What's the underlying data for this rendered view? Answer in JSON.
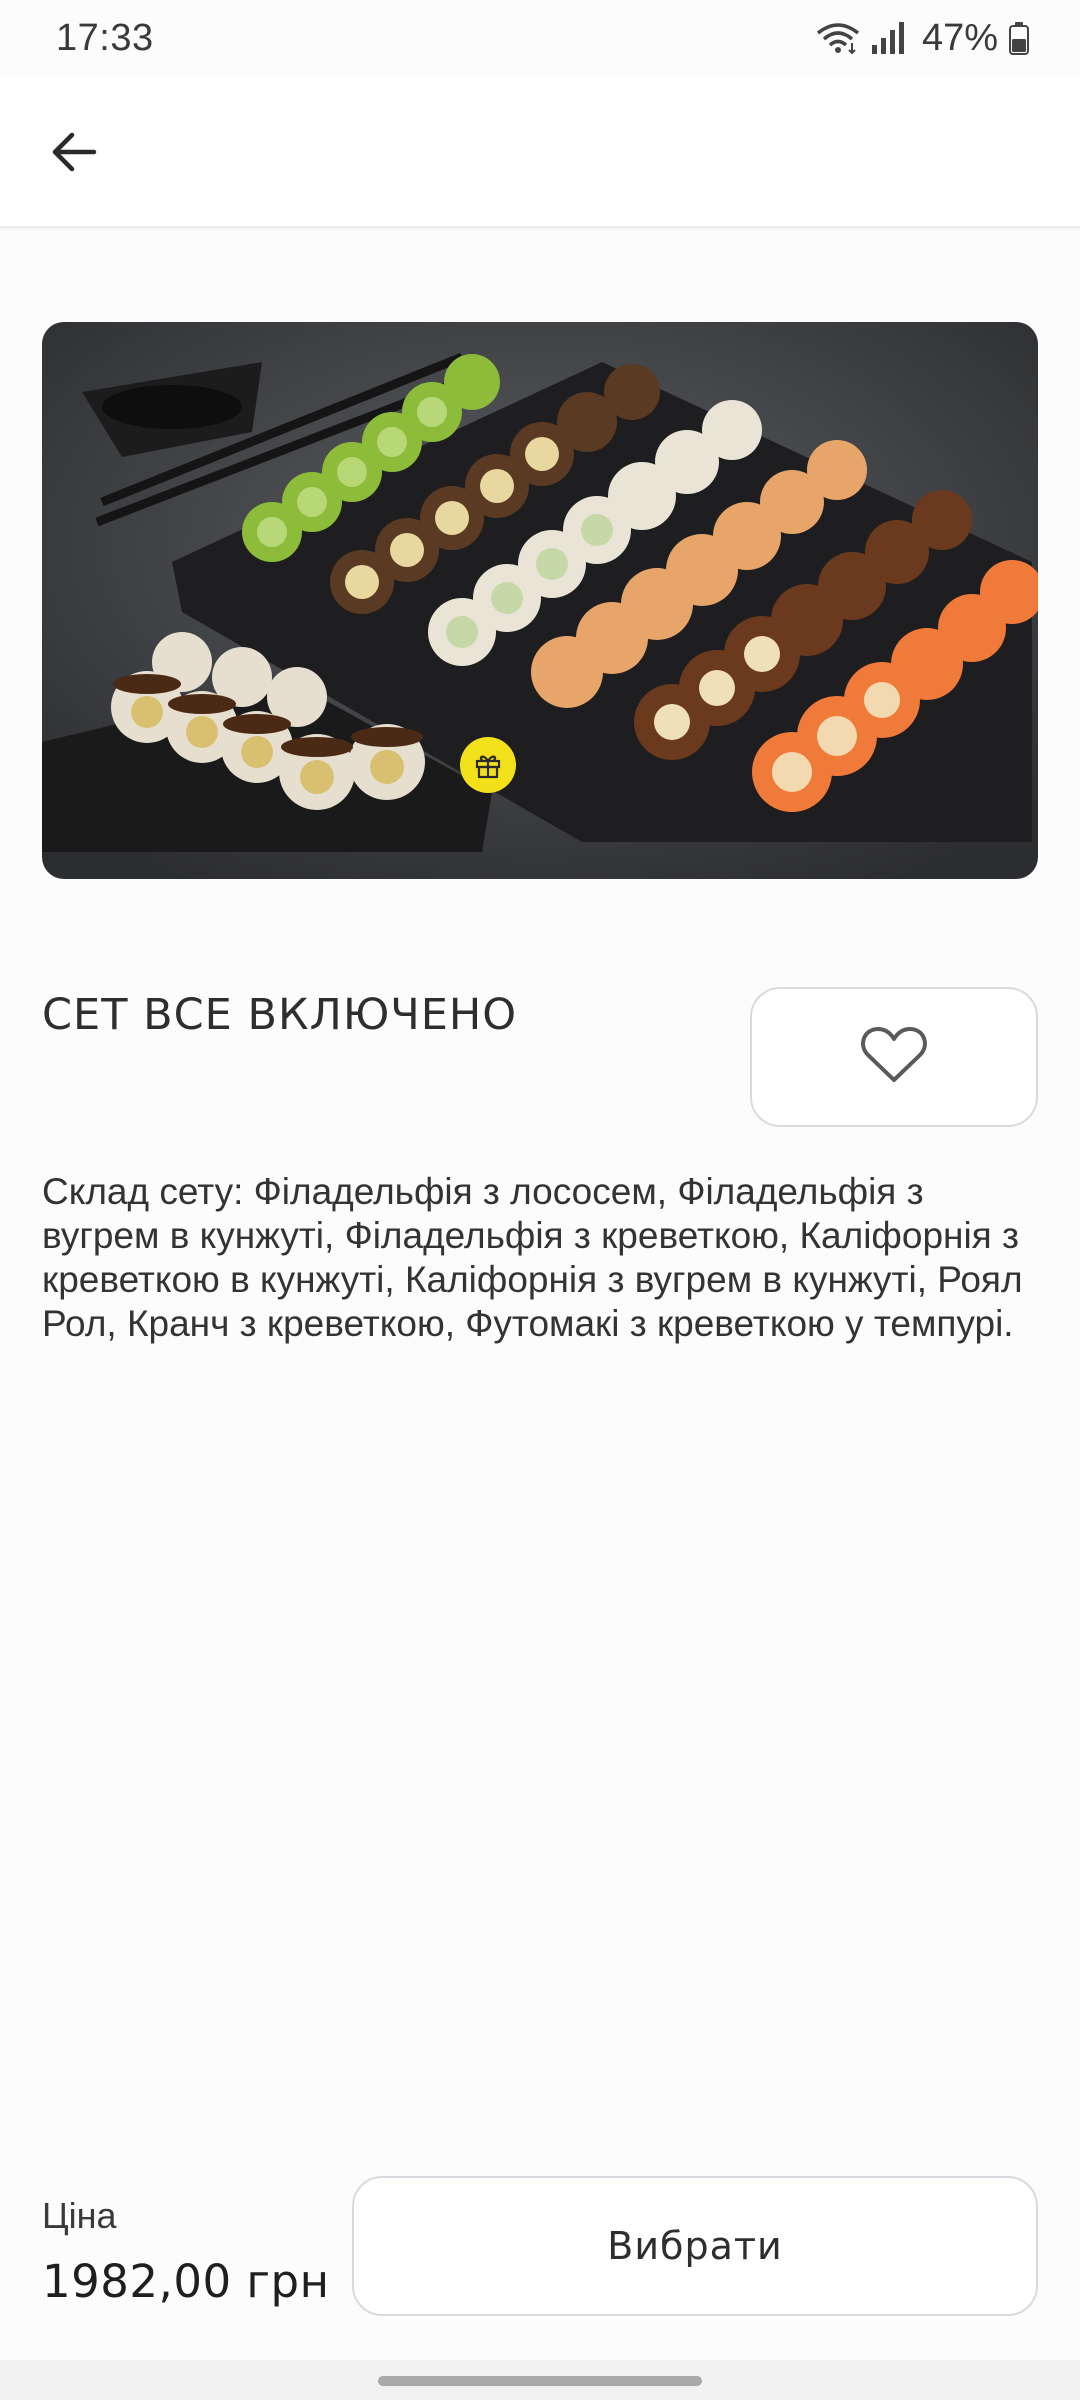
{
  "status_bar": {
    "time": "17:33",
    "battery": "47%",
    "icons": [
      "wifi-icon",
      "signal-icon",
      "battery-icon"
    ]
  },
  "app_bar": {
    "back_icon": "arrow-left-icon"
  },
  "product": {
    "image_alt": "sushi set photo",
    "badge_icon": "gift-icon",
    "title": "СЕТ ВСЕ ВКЛЮЧЕНО",
    "favorite_icon": "heart-outline-icon",
    "description": "Склад сету: Філадельфія з лососем, Філадельфія з вугрем в кунжуті, Філадельфія з креветкою, Каліфорнія з креветкою в кунжуті, Каліфорнія з вугрем в кунжуті, Роял Рол, Кранч з креветкою, Футомакі з креветкою у темпурі."
  },
  "footer": {
    "price_label": "Ціна",
    "price_value": "1982,00 грн",
    "select_label": "Вибрати"
  },
  "colors": {
    "background": "#fdfcfc",
    "border": "#d9d9e0",
    "badge": "#f2e01b"
  }
}
